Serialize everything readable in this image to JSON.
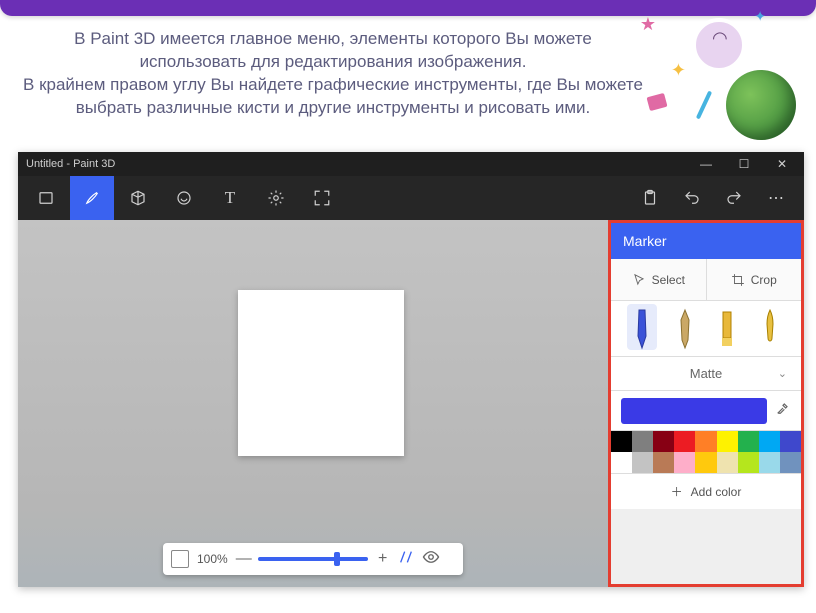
{
  "slide": {
    "text": "В Paint 3D имеется главное меню, элементы которого Вы можете использовать для редактирования изображения.\nВ крайнем правом углу Вы найдете графические инструменты, где Вы можете выбрать различные кисти и другие инструменты и рисовать ими."
  },
  "app": {
    "title": "Untitled - Paint 3D",
    "window_controls": {
      "min": "—",
      "max": "☐",
      "close": "✕"
    },
    "topbar": {
      "menu_icon": "menu",
      "tools": [
        {
          "id": "brushes",
          "active": true
        },
        {
          "id": "3d-shapes",
          "active": false
        },
        {
          "id": "stickers",
          "active": false
        },
        {
          "id": "text",
          "active": false
        },
        {
          "id": "effects",
          "active": false
        },
        {
          "id": "canvas",
          "active": false
        }
      ],
      "right": [
        {
          "id": "paste"
        },
        {
          "id": "undo"
        },
        {
          "id": "redo"
        },
        {
          "id": "more"
        }
      ]
    },
    "zoom": {
      "label": "100%",
      "minus": "—",
      "plus": "+"
    },
    "sidebar": {
      "title": "Marker",
      "select": "Select",
      "crop": "Crop",
      "brushes": [
        "marker",
        "calligraphy",
        "oil",
        "watercolor"
      ],
      "material": "Matte",
      "current_color": "#3a3ae6",
      "palette": [
        "#000000",
        "#7f7f7f",
        "#870014",
        "#ec1c23",
        "#ff7f26",
        "#fef200",
        "#23b14d",
        "#00a8f3",
        "#3f48cc",
        "#ffffff",
        "#c3c3c3",
        "#b97a56",
        "#feaec9",
        "#ffc90d",
        "#efe3af",
        "#b5e61d",
        "#99d9ea",
        "#7092be"
      ],
      "add_color": "Add color"
    }
  }
}
